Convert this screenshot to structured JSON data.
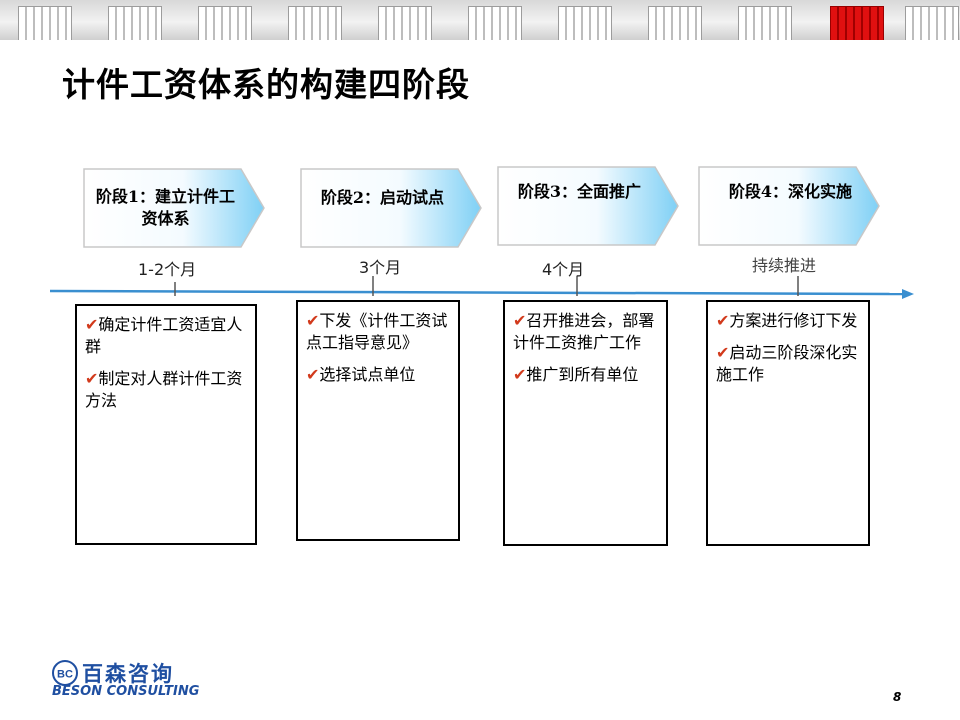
{
  "title": "计件工资体系的构建四阶段",
  "stages": [
    {
      "label": "阶段1：建立计件工资体系",
      "period": "1-2个月",
      "items": [
        "确定计件工资适宜人群",
        "制定对人群计件工资方法"
      ]
    },
    {
      "label": "阶段2：启动试点",
      "period": "3个月",
      "items": [
        "下发《计件工资试点工指导意见》",
        "选择试点单位"
      ]
    },
    {
      "label": "阶段3：全面推广",
      "period": "4个月",
      "items": [
        "召开推进会，部署计件工资推广工作",
        "推广到所有单位"
      ]
    },
    {
      "label": "阶段4：深化实施",
      "period": "持续推进",
      "items": [
        "方案进行修订下发",
        "启动三阶段深化实施工作"
      ]
    }
  ],
  "check_mark": "✔",
  "logo": {
    "cn": "百森咨询",
    "en": "BESON CONSULTING",
    "badge": "BC"
  },
  "page_number": "8",
  "colors": {
    "accent": "#1f4fa1",
    "check": "#d23a1c",
    "timeline": "#3a8fd0"
  }
}
